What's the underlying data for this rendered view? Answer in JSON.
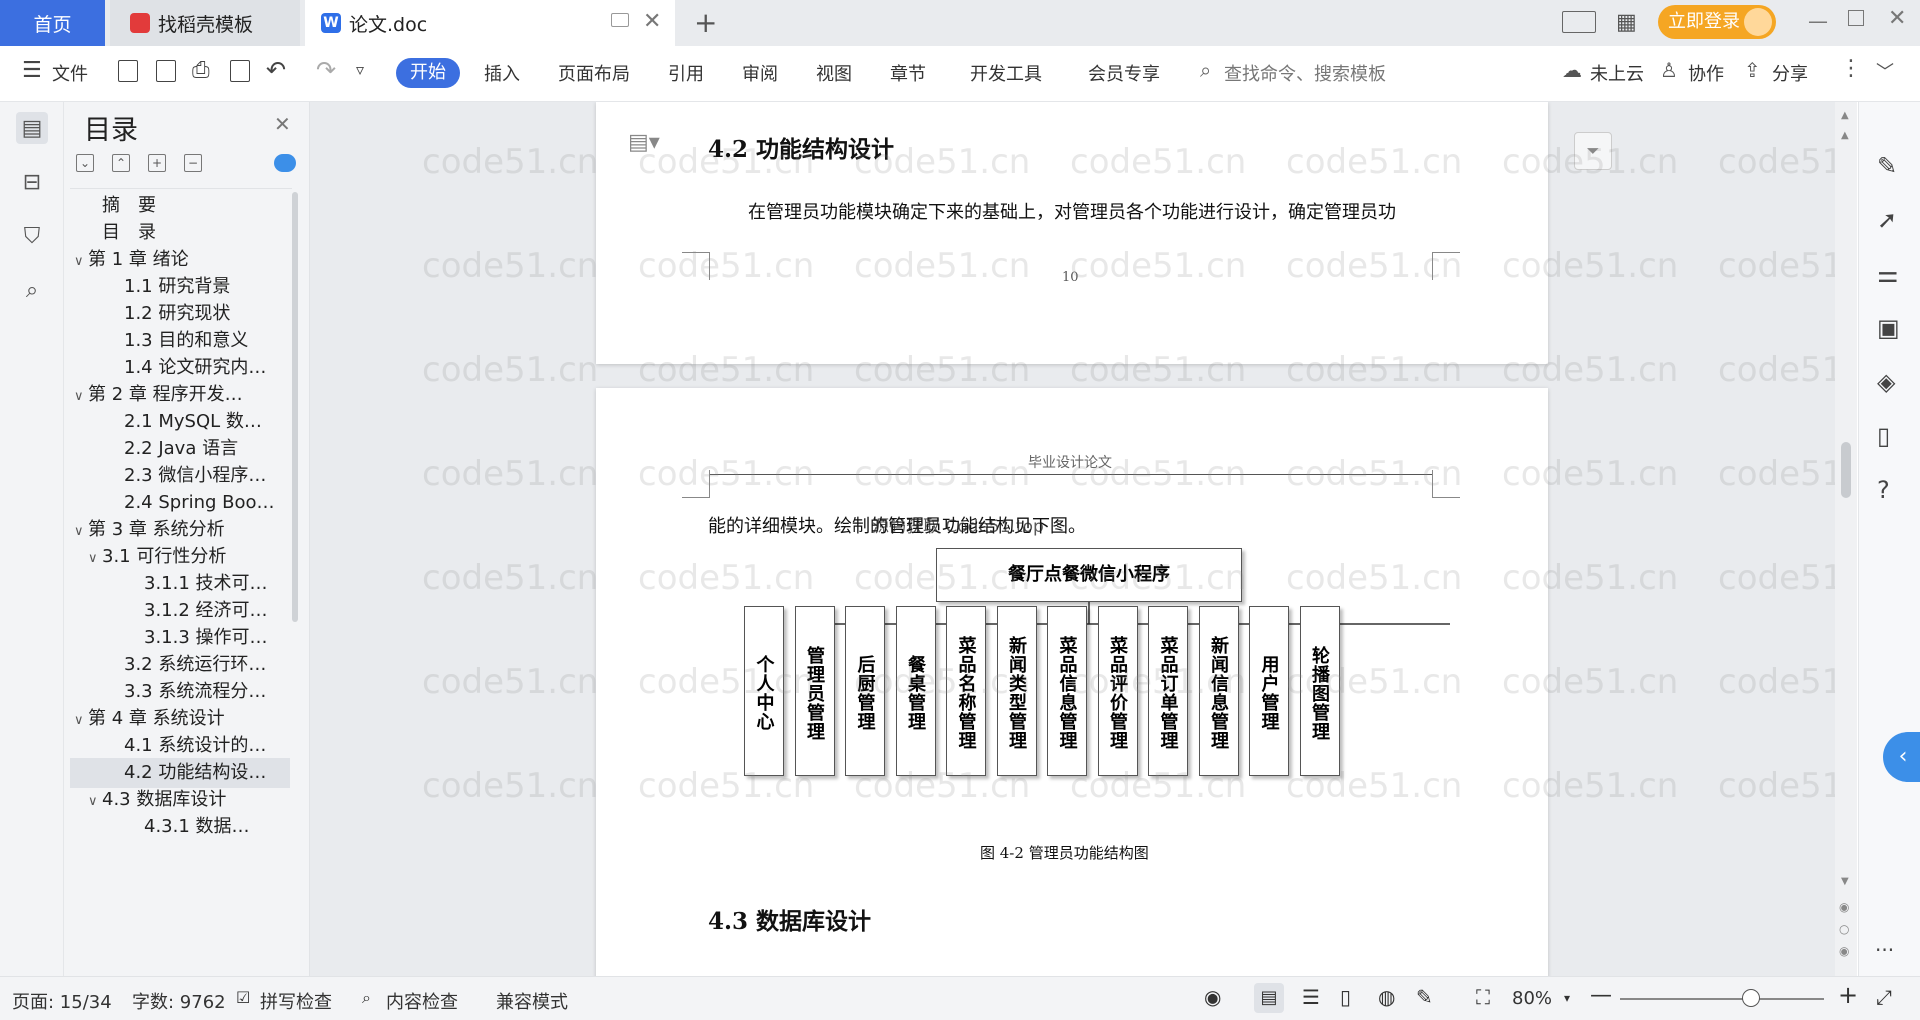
{
  "tabs": {
    "home": "首页",
    "templates": "找稻壳模板",
    "doc": "论文.doc",
    "login": "立即登录"
  },
  "ribbon": {
    "file": "文件",
    "menus": [
      "开始",
      "插入",
      "页面布局",
      "引用",
      "审阅",
      "视图",
      "章节",
      "开发工具",
      "会员专享"
    ],
    "search_placeholder": "查找命令、搜索模板",
    "cloud": "未上云",
    "collab": "协作",
    "share": "分享"
  },
  "toc": {
    "title": "目录",
    "items": [
      {
        "text": "摘　要",
        "level": 1,
        "chev": false
      },
      {
        "text": "目　录",
        "level": 1,
        "chev": false
      },
      {
        "text": "第 1 章  绪论",
        "level": 0,
        "chev": true
      },
      {
        "text": "1.1  研究背景",
        "level": 2,
        "chev": false
      },
      {
        "text": "1.2  研究现状",
        "level": 2,
        "chev": false
      },
      {
        "text": "1.3  目的和意义",
        "level": 2,
        "chev": false
      },
      {
        "text": "1.4  论文研究内…",
        "level": 2,
        "chev": false
      },
      {
        "text": "第 2 章  程序开发…",
        "level": 0,
        "chev": true
      },
      {
        "text": "2.1  MySQL 数…",
        "level": 2,
        "chev": false
      },
      {
        "text": "2.2  Java 语言",
        "level": 2,
        "chev": false
      },
      {
        "text": "2.3  微信小程序…",
        "level": 2,
        "chev": false
      },
      {
        "text": "2.4  Spring Boo…",
        "level": 2,
        "chev": false
      },
      {
        "text": "第 3 章  系统分析",
        "level": 0,
        "chev": true
      },
      {
        "text": "3.1  可行性分析",
        "level": 1,
        "chev": true
      },
      {
        "text": "3.1.1  技术可…",
        "level": 3,
        "chev": false
      },
      {
        "text": "3.1.2  经济可…",
        "level": 3,
        "chev": false
      },
      {
        "text": "3.1.3  操作可…",
        "level": 3,
        "chev": false
      },
      {
        "text": "3.2  系统运行环…",
        "level": 2,
        "chev": false
      },
      {
        "text": "3.3  系统流程分…",
        "level": 2,
        "chev": false
      },
      {
        "text": "第 4 章  系统设计",
        "level": 0,
        "chev": true
      },
      {
        "text": "4.1  系统设计的…",
        "level": 2,
        "chev": false
      },
      {
        "text": "4.2  功能结构设…",
        "level": 2,
        "chev": false,
        "active": true
      },
      {
        "text": "4.3  数据库设计",
        "level": 1,
        "chev": true
      },
      {
        "text": "4.3.1  数据…",
        "level": 3,
        "chev": false
      }
    ]
  },
  "page1": {
    "heading": "4.2  功能结构设计",
    "para": "在管理员功能模块确定下来的基础上，对管理员各个功能进行设计，确定管理员功",
    "page_num": "10"
  },
  "page2": {
    "header": "毕业设计论文",
    "para": "能的详细模块。绘制的管理员功能结构见下图。",
    "overlap": "源码获取 Code51.top",
    "diagram_root": "餐厅点餐微信小程序",
    "diagram_children": [
      "个人中心",
      "管理员管理",
      "后厨管理",
      "餐桌管理",
      "菜品名称管理",
      "新闻类型管理",
      "菜品信息管理",
      "菜品评价管理",
      "菜品订单管理",
      "新闻信息管理",
      "用户管理",
      "轮播图管理"
    ],
    "caption": "图 4-2  管理员功能结构图",
    "heading2": "4.3  数据库设计"
  },
  "watermark": "code51.cn",
  "status": {
    "page": "页面: 15/34",
    "words": "字数: 9762",
    "spell": "拼写检查",
    "content": "内容检查",
    "compat": "兼容模式",
    "zoom": "80%"
  }
}
